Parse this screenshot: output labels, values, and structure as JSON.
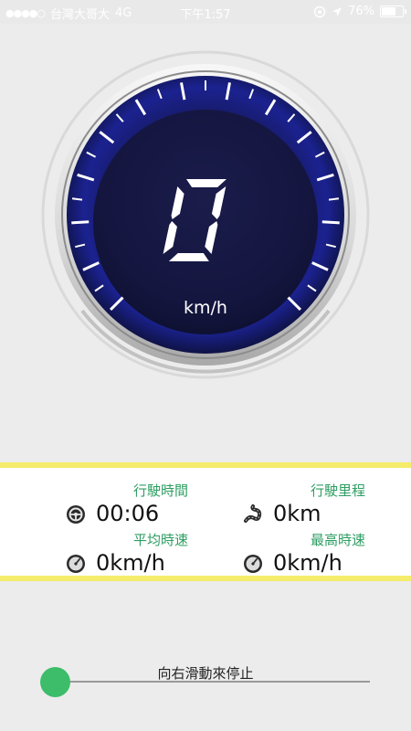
{
  "status_bar": {
    "carrier": "台灣大哥大",
    "network": "4G",
    "time": "下午1:57",
    "battery": "76%",
    "battery_level": 0.76
  },
  "speedometer": {
    "speed": "0",
    "unit": "km/h"
  },
  "stats": {
    "drive_time": {
      "label": "行駛時間",
      "value": "00:06",
      "icon": "steering-wheel-icon"
    },
    "distance": {
      "label": "行駛里程",
      "value": "0km",
      "icon": "winding-road-icon"
    },
    "avg_speed": {
      "label": "平均時速",
      "value": "0km/h",
      "icon": "gauge-icon"
    },
    "max_speed": {
      "label": "最高時速",
      "value": "0km/h",
      "icon": "gauge-icon"
    }
  },
  "slider": {
    "hint": "向右滑動來停止",
    "position": 0
  },
  "colors": {
    "accent_green": "#3dbd6a",
    "label_green": "#2e9e63",
    "highlight_yellow": "#f4ec6a",
    "dial_blue": "#1a1f7a"
  }
}
